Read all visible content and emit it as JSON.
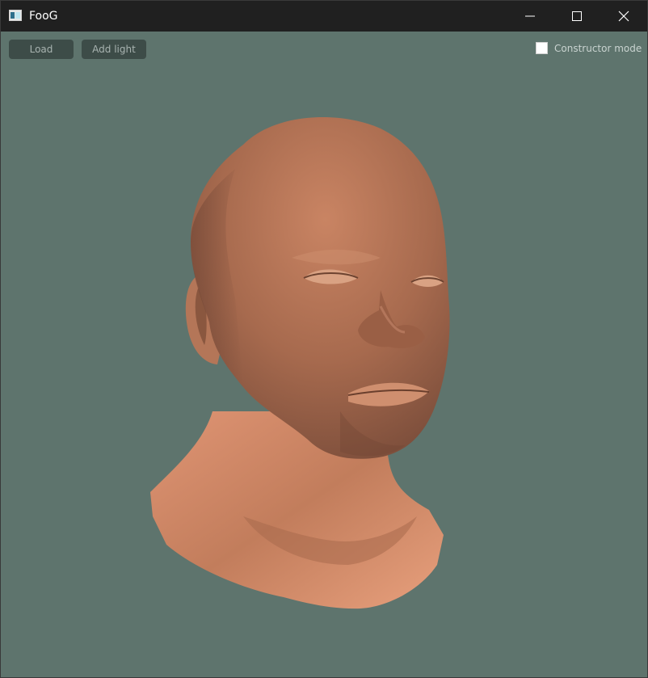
{
  "window": {
    "title": "FooG"
  },
  "toolbar": {
    "load_label": "Load",
    "add_light_label": "Add light"
  },
  "constructor_mode": {
    "label": "Constructor mode",
    "checked": false
  },
  "viewport": {
    "model": "human head mesh",
    "background_color": "#5e746d",
    "skin_color": "#d08a66"
  }
}
